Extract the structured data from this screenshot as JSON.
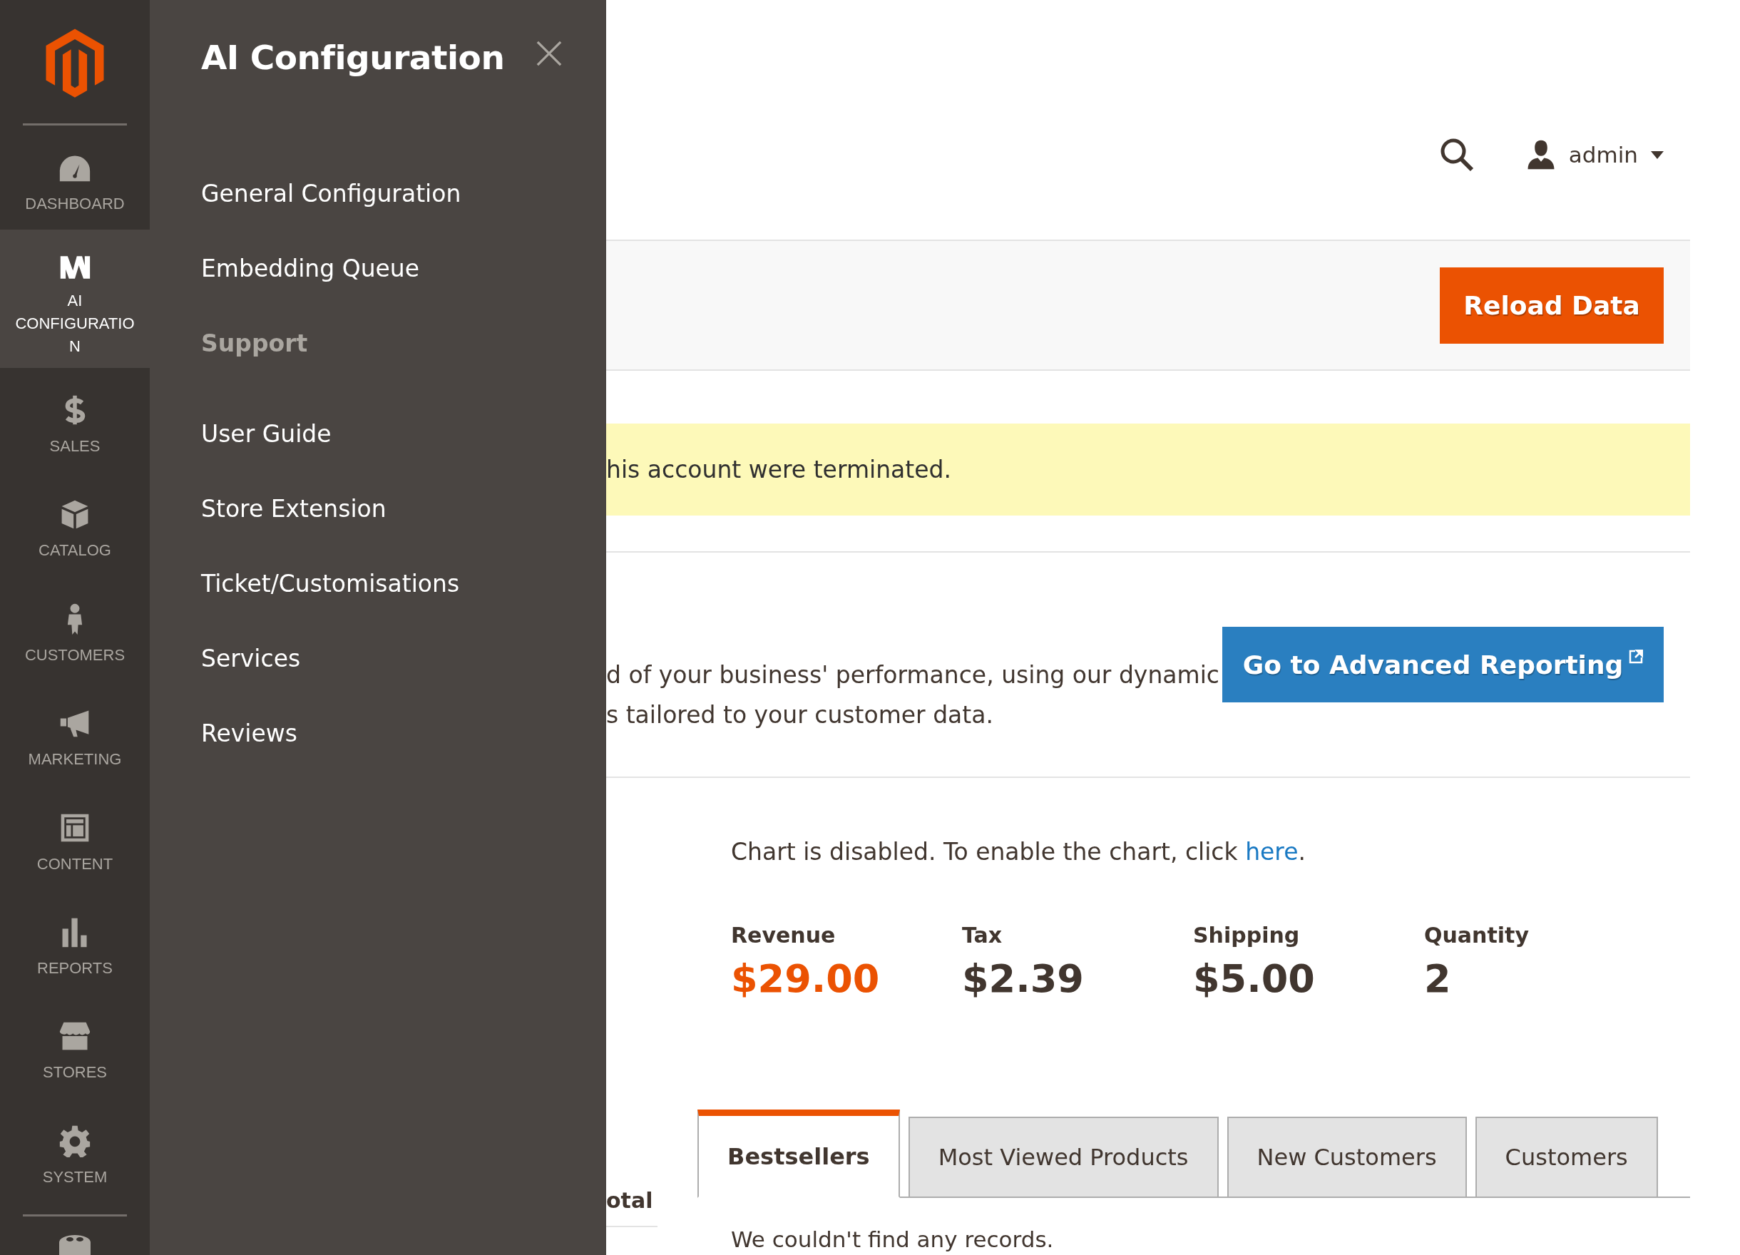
{
  "sidebar": {
    "items": [
      {
        "label": "DASHBOARD",
        "selected": false
      },
      {
        "label": "AI CONFIGURATION",
        "selected": true
      },
      {
        "label": "SALES",
        "selected": false
      },
      {
        "label": "CATALOG",
        "selected": false
      },
      {
        "label": "CUSTOMERS",
        "selected": false
      },
      {
        "label": "MARKETING",
        "selected": false
      },
      {
        "label": "CONTENT",
        "selected": false
      },
      {
        "label": "REPORTS",
        "selected": false
      },
      {
        "label": "STORES",
        "selected": false
      },
      {
        "label": "SYSTEM",
        "selected": false
      }
    ]
  },
  "flyout": {
    "title": "AI Configuration",
    "items": [
      {
        "kind": "link",
        "label": "General Configuration"
      },
      {
        "kind": "link",
        "label": "Embedding Queue"
      },
      {
        "kind": "heading",
        "label": "Support"
      },
      {
        "kind": "link",
        "label": "User Guide"
      },
      {
        "kind": "link",
        "label": "Store Extension"
      },
      {
        "kind": "link",
        "label": "Ticket/Customisations"
      },
      {
        "kind": "link",
        "label": "Services"
      },
      {
        "kind": "link",
        "label": "Reviews"
      }
    ]
  },
  "header": {
    "user": "admin"
  },
  "toolbar": {
    "button": "Reload Data"
  },
  "notice": {
    "text": "his account were terminated."
  },
  "advanced_reporting": {
    "lines": [
      "d of your business' performance, using our dynamic",
      "s tailored to your customer data."
    ],
    "button": "Go to Advanced Reporting"
  },
  "chart_note": {
    "text": "Chart is disabled. To enable the chart, click ",
    "link": "here",
    "end": "."
  },
  "totals": [
    {
      "label": "Revenue",
      "value": "$29.00",
      "highlight": true
    },
    {
      "label": "Tax",
      "value": "$2.39",
      "highlight": false
    },
    {
      "label": "Shipping",
      "value": "$5.00",
      "highlight": false
    },
    {
      "label": "Quantity",
      "value": "2",
      "highlight": false
    }
  ],
  "left_column_header": "otal",
  "tabs": [
    {
      "label": "Bestsellers",
      "selected": true
    },
    {
      "label": "Most Viewed Products",
      "selected": false
    },
    {
      "label": "New Customers",
      "selected": false
    },
    {
      "label": "Customers",
      "selected": false
    }
  ],
  "empty_message": "We couldn't find any records."
}
